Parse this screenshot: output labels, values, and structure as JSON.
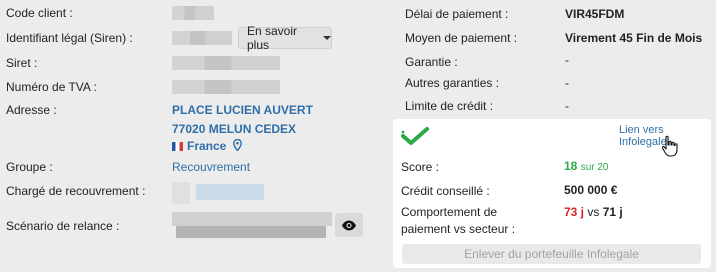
{
  "left": {
    "labels": {
      "code_client": "Code client :",
      "siren": "Identifiant légal (Siren) :",
      "siret": "Siret :",
      "tva": "Numéro de TVA :",
      "adresse": "Adresse :",
      "groupe": "Groupe :",
      "charge": "Chargé de recouvrement :",
      "scenario": "Scénario de relance :"
    },
    "more_button": "En savoir plus",
    "address": {
      "line1": "PLACE LUCIEN AUVERT",
      "line2": "77020 MELUN CEDEX",
      "country": "France"
    },
    "groupe_value": "Recouvrement"
  },
  "right": {
    "rows": [
      {
        "label": "Délai de paiement :",
        "value": "VIR45FDM"
      },
      {
        "label": "Moyen de paiement :",
        "value": "Virement 45 Fin de Mois"
      },
      {
        "label": "Garantie :",
        "value": "-"
      },
      {
        "label": "Autres garanties :",
        "value": "-"
      },
      {
        "label": "Limite de crédit :",
        "value": "-"
      }
    ]
  },
  "card": {
    "infolink": "Lien vers Infolegale",
    "score_label": "Score :",
    "score_value": "18",
    "score_suffix": "sur 20",
    "credit_label": "Crédit conseillé :",
    "credit_value": "500 000 €",
    "behavior_label_1": "Comportement de",
    "behavior_label_2": "paiement vs secteur :",
    "behavior_value": "73 j",
    "behavior_vs": "vs",
    "behavior_sector": "71 j",
    "remove_button": "Enlever du portefeuille Infolegale"
  },
  "colors": {
    "link": "#2f6fa8",
    "score_green": "#2ba84a",
    "delay_red": "#d62424",
    "background": "#ececec"
  },
  "icons": [
    "chevron-down-icon",
    "map-pin-icon",
    "flag-france-icon",
    "eye-icon",
    "check-icon",
    "hand-cursor-icon"
  ]
}
